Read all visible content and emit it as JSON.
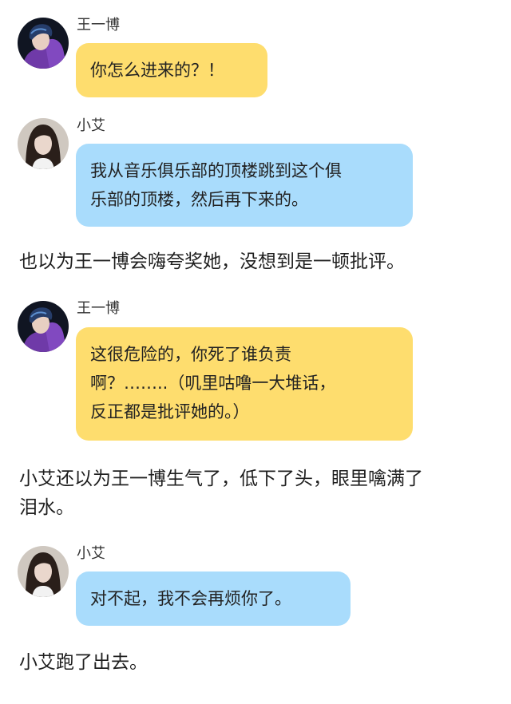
{
  "speakers": {
    "wang": {
      "name": "王一博",
      "avatar_icon": "boy-purple-hoodie-avatar",
      "bubble_color": "#fedd6e"
    },
    "xiaoai": {
      "name": "小艾",
      "avatar_icon": "girl-long-hair-avatar",
      "bubble_color": "#a9dcfc"
    }
  },
  "messages": [
    {
      "speaker": "王一博",
      "lines": [
        "你怎么进来的？！"
      ]
    },
    {
      "speaker": "小艾",
      "lines": [
        "我从音乐俱乐部的顶楼跳到这个俱",
        "乐部的顶楼，然后再下来的。"
      ]
    },
    {
      "speaker": "王一博",
      "lines": [
        "这很危险的，你死了谁负责",
        "啊？……..（叽里咕噜一大堆话，",
        "反正都是批评她的。）"
      ]
    },
    {
      "speaker": "小艾",
      "lines": [
        "对不起，我不会再烦你了。"
      ]
    }
  ],
  "narrations": [
    {
      "lines": [
        "也以为王一博会嗨夸奖她，没想到是一顿批评。"
      ]
    },
    {
      "lines": [
        "小艾还以为王一博生气了，低下了头，眼里噙满了",
        "泪水。"
      ]
    },
    {
      "lines": [
        "小艾跑了出去。"
      ]
    }
  ]
}
